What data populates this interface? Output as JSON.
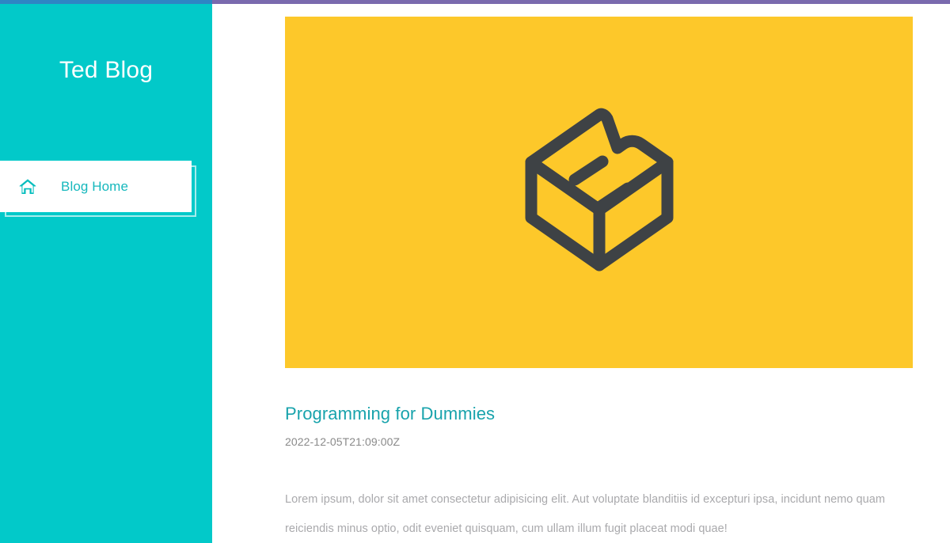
{
  "browser_chrome": {
    "top_strip": {
      "left_color": "#2e85c4",
      "right_color": "#7a6aae"
    }
  },
  "theme": {
    "sidebar_bg": "#02c9c9",
    "accent_teal": "#16b8bd",
    "title_teal": "#18a3ac",
    "hero_yellow": "#fdc82a",
    "hero_icon_color": "#3e4245",
    "body_text": "#a9a9ac",
    "date_text": "#8a8a8a",
    "page_bg": "#ffffff"
  },
  "sidebar": {
    "brand": "Ted Blog",
    "nav": [
      {
        "id": "blog-home",
        "label": "Blog Home",
        "icon": "home-icon",
        "active": true
      }
    ]
  },
  "main": {
    "post": {
      "hero_icon": "isometric-box-logo-icon",
      "title": "Programming for Dummies",
      "date": "2022-12-05T21:09:00Z",
      "body": "Lorem ipsum, dolor sit amet consectetur adipisicing elit. Aut voluptate blanditiis id excepturi ipsa, incidunt nemo quam reiciendis minus optio, odit eveniet quisquam, cum ullam illum fugit placeat modi quae!"
    }
  }
}
